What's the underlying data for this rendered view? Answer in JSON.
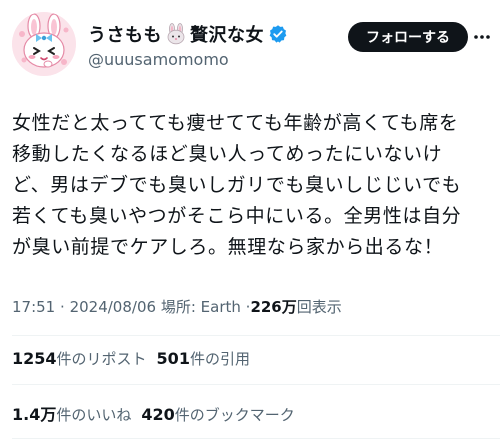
{
  "profile": {
    "display_name_prefix": "うさもも",
    "display_name_suffix": "贅沢な女",
    "handle": "@uuusamomomo",
    "follow_label": "フォローする"
  },
  "tweet": {
    "text": "女性だと太ってても痩せてても年齢が高くても席を\n移動したくなるほど臭い人ってめったにいないけ\nど、男はデブでも臭いしガリでも臭いしじじいでも\n若くても臭いやつがそこら中にいる。全男性は自分\nが臭い前提でケアしろ。無理なら家から出るな！"
  },
  "meta": {
    "time": "17:51",
    "sep1": "·",
    "date": "2024/08/06",
    "place_label": "場所: Earth",
    "sep2": "·",
    "views_num": "226万",
    "views_label": "回表示"
  },
  "stats": {
    "reposts_num": "1254",
    "reposts_label": "件のリポスト",
    "quotes_num": "501",
    "quotes_label": "件の引用",
    "likes_num": "1.4万",
    "likes_label": "件のいいね",
    "bookmarks_num": "420",
    "bookmarks_label": "件のブックマーク"
  },
  "icons": {
    "avatar": "bunny-girl-avatar",
    "emoji": "rabbit-face-emoji",
    "verified": "verified-badge-icon",
    "menu": "more-menu-icon"
  },
  "colors": {
    "follow_bg": "#0f1419",
    "verified": "#1d9bf0",
    "muted": "#536471"
  }
}
